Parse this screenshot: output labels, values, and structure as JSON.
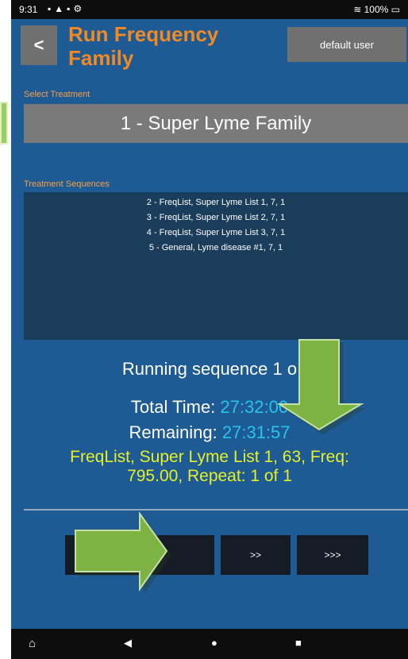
{
  "status_bar": {
    "time": "9:31",
    "icons": "▪▲▪⚙",
    "battery": "100%",
    "wifi_icon": "wifi-icon"
  },
  "header": {
    "back_label": "<",
    "title": "Run Frequency Family",
    "user_label": "default user"
  },
  "select_treatment": {
    "label": "Select Treatment",
    "value": "1 - Super Lyme Family"
  },
  "sequences": {
    "label": "Treatment Sequences",
    "items": [
      "2 - FreqList, Super Lyme List 1, 7, 1",
      "3 - FreqList, Super Lyme List 2, 7, 1",
      "4 - FreqList, Super Lyme List 3, 7, 1",
      "5 - General, Lyme disease #1, 7, 1"
    ]
  },
  "run_status": {
    "running_text": "Running sequence 1 o",
    "total_time_label": "Total Time:",
    "total_time_value": "27:32:00",
    "remaining_label": "Remaining:",
    "remaining_value": "27:31:57",
    "freq_line1": "FreqList, Super Lyme List 1, 63, Freq:",
    "freq_line2": "795.00, Repeat: 1 of 1"
  },
  "controls": {
    "pause_label": "II",
    "next_label": ">>",
    "skip_label": ">>>"
  },
  "colors": {
    "background": "#1e5a94",
    "accent_orange": "#f08a24",
    "time_cyan": "#29c4e8",
    "freq_yellow": "#e6f028",
    "annotation_green": "#7cb342"
  }
}
